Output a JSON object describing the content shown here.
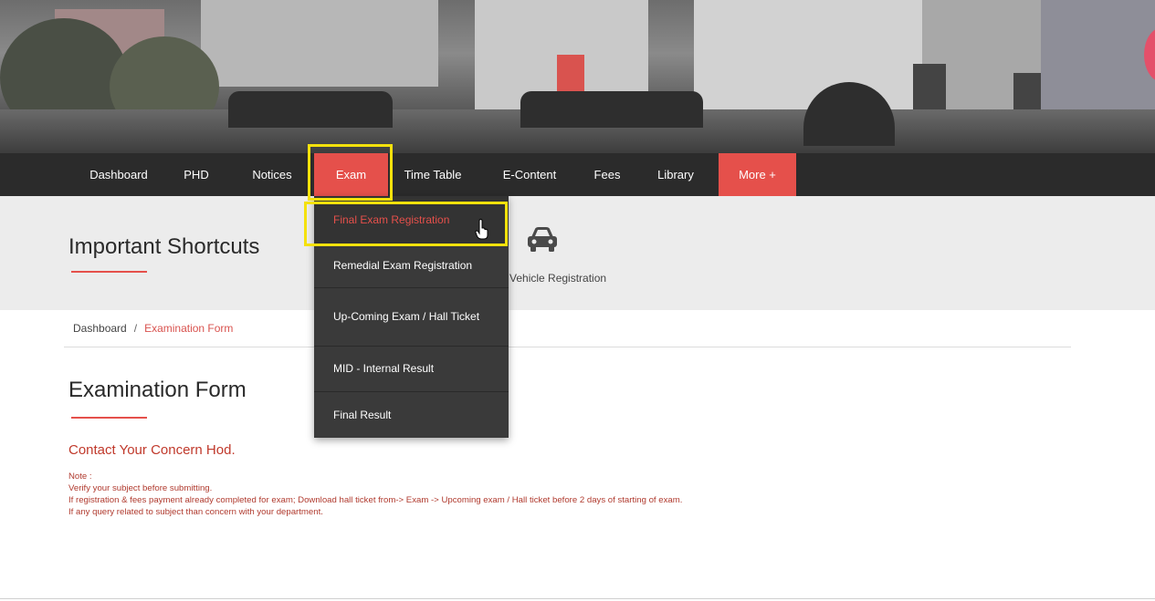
{
  "nav": {
    "items": [
      {
        "label": "Dashboard"
      },
      {
        "label": "PHD"
      },
      {
        "label": "Notices"
      },
      {
        "label": "Exam"
      },
      {
        "label": "Time Table"
      },
      {
        "label": "E-Content"
      },
      {
        "label": "Fees"
      },
      {
        "label": "Library"
      },
      {
        "label": "More +"
      }
    ],
    "active": "Exam"
  },
  "dropdown": {
    "items": [
      {
        "label": "Final Exam Registration"
      },
      {
        "label": "Remedial Exam Registration"
      },
      {
        "label": "Up-Coming Exam / Hall Ticket"
      },
      {
        "label": "MID - Internal Result"
      },
      {
        "label": "Final Result"
      }
    ]
  },
  "shortcuts": {
    "title": "Important Shortcuts",
    "vehicle_label": "Vehicle Registration",
    "vehicle_icon": "car-icon"
  },
  "breadcrumb": {
    "home": "Dashboard",
    "separator": "/",
    "current": "Examination Form"
  },
  "form": {
    "title": "Examination Form",
    "contact": "Contact Your Concern Hod.",
    "note_label": "Note :",
    "notes": [
      "Verify your subject before submitting.",
      "If registration & fees payment already completed for exam; Download hall ticket from-> Exam -> Upcoming exam / Hall ticket before 2 days of starting of exam.",
      "If any query related to subject than concern with your department."
    ]
  },
  "colors": {
    "accent": "#e5504b",
    "navbar": "#2b2b2b",
    "highlight": "#f4e10c",
    "dropdown_bg": "#3a3a3a"
  }
}
